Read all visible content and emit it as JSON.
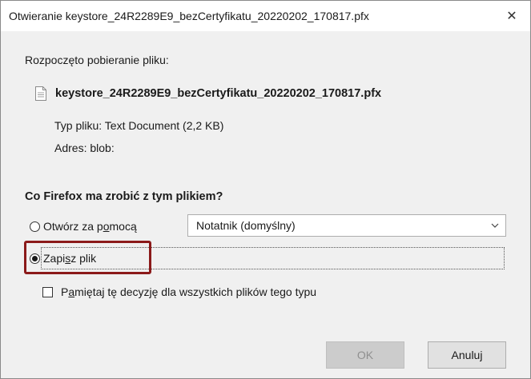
{
  "window": {
    "title": "Otwieranie keystore_24R2289E9_bezCertyfikatu_20220202_170817.pfx",
    "close_label": "✕"
  },
  "download": {
    "started_label": "Rozpoczęto pobieranie pliku:",
    "file_name": "keystore_24R2289E9_bezCertyfikatu_20220202_170817.pfx",
    "type_label": "Typ pliku:",
    "type_value": "Text Document (2,2 KB)",
    "address_label": "Adres:",
    "address_value": "blob:"
  },
  "action": {
    "question": "Co Firefox ma zrobić z tym plikiem?",
    "open_with_pre": "Otwórz za p",
    "open_with_accel": "o",
    "open_with_post": "mocą",
    "open_with_app": "Notatnik (domyślny)",
    "save_pre": "Zapi",
    "save_accel": "s",
    "save_post": "z plik",
    "save_selected": true,
    "remember_pre": "P",
    "remember_accel": "a",
    "remember_post": "miętaj tę decyzję dla wszystkich plików tego typu",
    "remember_checked": false
  },
  "buttons": {
    "ok_label": "OK",
    "cancel_label": "Anuluj"
  },
  "colors": {
    "highlight": "#8b1a1a",
    "dialog_bg": "#f0f0f0",
    "title_bg": "#ffffff"
  }
}
